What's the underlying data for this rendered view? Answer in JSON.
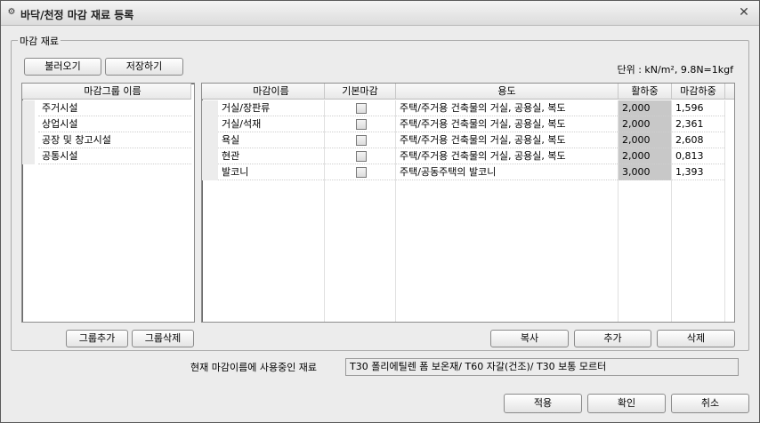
{
  "window": {
    "title": "바닥/천정 마감 재료 등록",
    "title_icon": "gear-icon",
    "close_icon": "close-icon"
  },
  "group": {
    "legend": "마감 재료",
    "load_button": "불러오기",
    "save_button": "저장하기",
    "unit_text": "단위 : kN/m², 9.8N=1kgf"
  },
  "group_list": {
    "header": "마감그룹 이름",
    "items": [
      "주거시설",
      "상업시설",
      "공장 및 창고시설",
      "공통시설"
    ],
    "add_button": "그룹추가",
    "delete_button": "그룹삭제"
  },
  "finish_table": {
    "headers": {
      "name": "마감이름",
      "default": "기본마감",
      "usage": "용도",
      "live_load": "활하중",
      "finish_load": "마감하중"
    },
    "rows": [
      {
        "name": "거실/장판류",
        "default": false,
        "usage": "주택/주거용 건축물의 거실, 공용실, 복도",
        "live_load": "2,000",
        "finish_load": "1,596"
      },
      {
        "name": "거실/석재",
        "default": false,
        "usage": "주택/주거용 건축물의 거실, 공용실, 복도",
        "live_load": "2,000",
        "finish_load": "2,361"
      },
      {
        "name": "욕실",
        "default": false,
        "usage": "주택/주거용 건축물의 거실, 공용실, 복도",
        "live_load": "2,000",
        "finish_load": "2,608"
      },
      {
        "name": "현관",
        "default": false,
        "usage": "주택/주거용 건축물의 거실, 공용실, 복도",
        "live_load": "2,000",
        "finish_load": "0,813"
      },
      {
        "name": "발코니",
        "default": false,
        "usage": "주택/공동주택의 발코니",
        "live_load": "3,000",
        "finish_load": "1,393"
      }
    ],
    "copy_button": "복사",
    "add_button": "추가",
    "delete_button": "삭제"
  },
  "status": {
    "label": "현재 마감이름에 사용중인 재료",
    "value": "T30 폴리에틸렌 폼 보온재/ T60 자갈(건조)/ T30 보통 모르터"
  },
  "footer": {
    "apply_button": "적용",
    "ok_button": "확인",
    "cancel_button": "취소"
  }
}
